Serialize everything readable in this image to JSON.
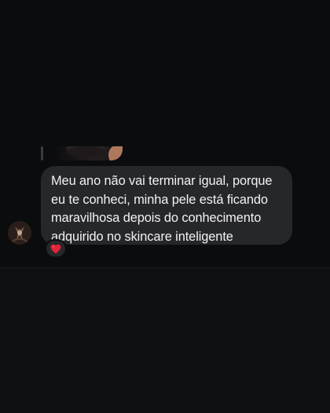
{
  "conversation": {
    "previous_message": {
      "type": "image",
      "icon": "photo-thumbnail"
    },
    "message": {
      "text_lines": [
        "Meu ano não vai terminar igual, porque",
        "eu te conheci, minha pele está ficando",
        "maravilhosa depois do conhecimento",
        "adquirido no skincare inteligente"
      ],
      "reaction": "❤️",
      "reaction_color": "#e0243a"
    },
    "sender": {
      "avatar_icon": "profile-avatar"
    }
  },
  "colors": {
    "background": "#0b0c0e",
    "bubble": "#26272b",
    "text": "#f2f2f4"
  }
}
